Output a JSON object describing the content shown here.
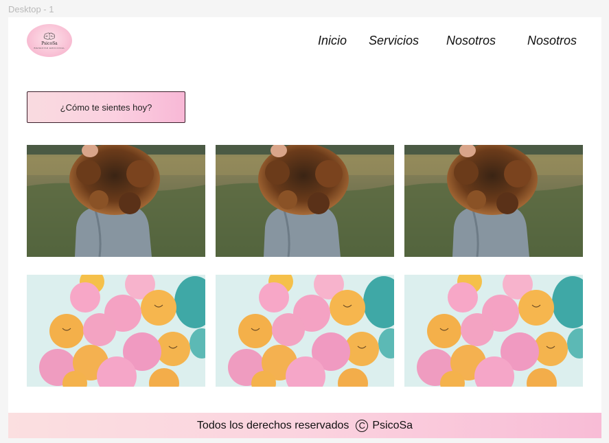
{
  "canvas": {
    "label": "Desktop - 1"
  },
  "logo": {
    "title": "PsicoSa",
    "subtitle": "BIENESTAR EMOCIONAL",
    "icon": "brain-icon"
  },
  "nav": {
    "items": [
      "Inicio",
      "Servicios",
      "Nosotros",
      "Nosotros"
    ]
  },
  "mood_button": {
    "label": "¿Cómo te sientes hoy?"
  },
  "gallery": {
    "row1": [
      "girl-curly-hair-field-photo",
      "girl-curly-hair-field-photo",
      "girl-curly-hair-field-photo"
    ],
    "row2": [
      "pink-orange-balloons-photo",
      "pink-orange-balloons-photo",
      "pink-orange-balloons-photo"
    ]
  },
  "footer": {
    "text": "Todos los derechos reservados",
    "copyright_symbol": "C",
    "brand": "PsicoSa"
  },
  "colors": {
    "accent_pink": "#f8b8d6",
    "light_pink": "#fbdfe0",
    "text": "#111111"
  }
}
